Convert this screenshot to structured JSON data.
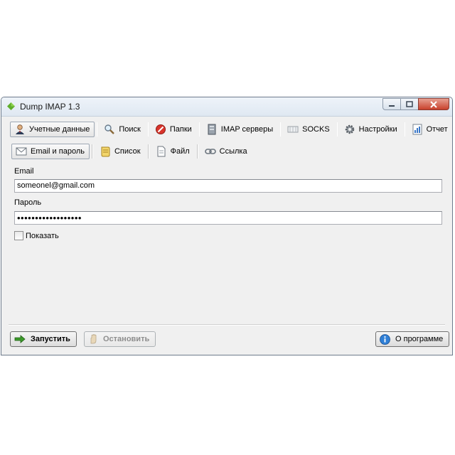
{
  "window": {
    "title": "Dump IMAP 1.3"
  },
  "tabs_main": [
    {
      "label": "Учетные данные",
      "icon": "user-icon",
      "active": true
    },
    {
      "label": "Поиск",
      "icon": "magnifier-icon"
    },
    {
      "label": "Папки",
      "icon": "no-entry-icon"
    },
    {
      "label": "IMAP серверы",
      "icon": "server-icon"
    },
    {
      "label": "SOCKS",
      "icon": "socks-icon"
    },
    {
      "label": "Настройки",
      "icon": "gear-icon"
    },
    {
      "label": "Отчет",
      "icon": "report-icon"
    }
  ],
  "tabs_sub": [
    {
      "label": "Email и пароль",
      "icon": "envelope-icon",
      "active": true
    },
    {
      "label": "Список",
      "icon": "scroll-icon"
    },
    {
      "label": "Файл",
      "icon": "file-icon"
    },
    {
      "label": "Ссылка",
      "icon": "link-icon"
    }
  ],
  "form": {
    "email_label": "Email",
    "email_value": "someonel@gmail.com",
    "password_label": "Пароль",
    "password_value": "••••••••••••••••••",
    "show_label": "Показать",
    "show_checked": false
  },
  "buttons": {
    "start": "Запустить",
    "stop": "Остановить",
    "about": "О программе"
  },
  "colors": {
    "accent": "#2f7fd6",
    "title_bar": "#dfe8f2",
    "close_button": "#c8412c"
  }
}
